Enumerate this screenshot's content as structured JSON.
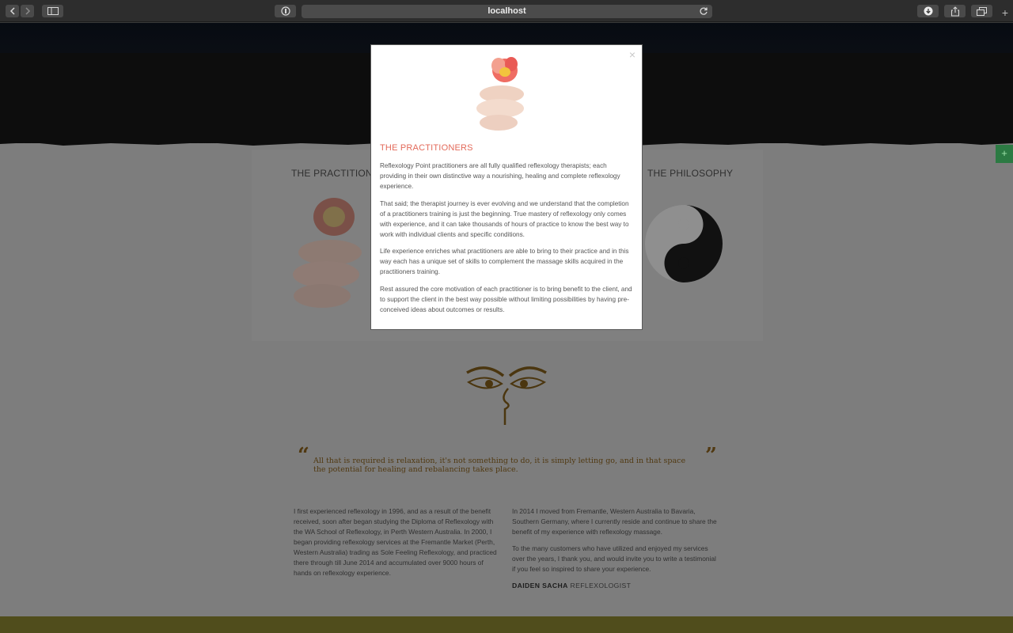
{
  "browser": {
    "url": "localhost"
  },
  "page": {
    "columns": {
      "left_heading": "THE PRACTITIONERS",
      "right_heading": "THE PHILOSOPHY"
    },
    "quote": {
      "open": "“",
      "text": "All that is required is relaxation, it's not something to do, it is simply letting go, and in that space the potential for healing and rebalancing takes place.",
      "close": "”"
    },
    "bio_left": [
      "I first experienced reflexology in 1996, and as a result of the benefit received, soon after began studying the Diploma of Reflexology with the WA School of Reflexology, in Perth Western Australia. In 2000, I began providing reflexology services at the Fremantle Market (Perth, Western Australia) trading as Sole Feeling Reflexology, and practiced there through till June 2014 and accumulated over 9000 hours of hands on reflexology experience."
    ],
    "bio_right": [
      "In 2014 I moved from Fremantle, Western Australia to Bavaria, Southern Germany, where I currently reside and continue to share the benefit of my experience with reflexology massage.",
      "To the many customers who have utilized and enjoyed my services over the years, I thank you, and would invite you to write a testimonial if you feel so inspired to share your experience."
    ],
    "signature_name": "DAIDEN SACHA",
    "signature_role": "REFLEXOLOGIST"
  },
  "modal": {
    "title": "THE PRACTITIONERS",
    "close": "×",
    "paragraphs": [
      "Reflexology Point practitioners are all fully qualified reflexology therapists; each providing in their own distinctive way a nourishing, healing and complete reflexology experience.",
      "That said; the therapist journey is ever evolving and we understand that the completion of a practitioners training is just the beginning. True mastery of reflexology only comes with experience, and it can take thousands of hours of practice to know the best way to work with individual clients and specific conditions.",
      "Life experience enriches what practitioners are able to bring to their practice and in this way each has a unique set of skills to complement the massage skills acquired in the practitioners training.",
      "Rest assured the core motivation of each practitioner is to bring benefit to the client, and to support the client in the best way possible without limiting possibilities by having pre-conceived ideas about outcomes or results."
    ]
  },
  "colors": {
    "accent": "#e36a5a",
    "side_tab": "#2c7a43",
    "quote": "#513911"
  }
}
